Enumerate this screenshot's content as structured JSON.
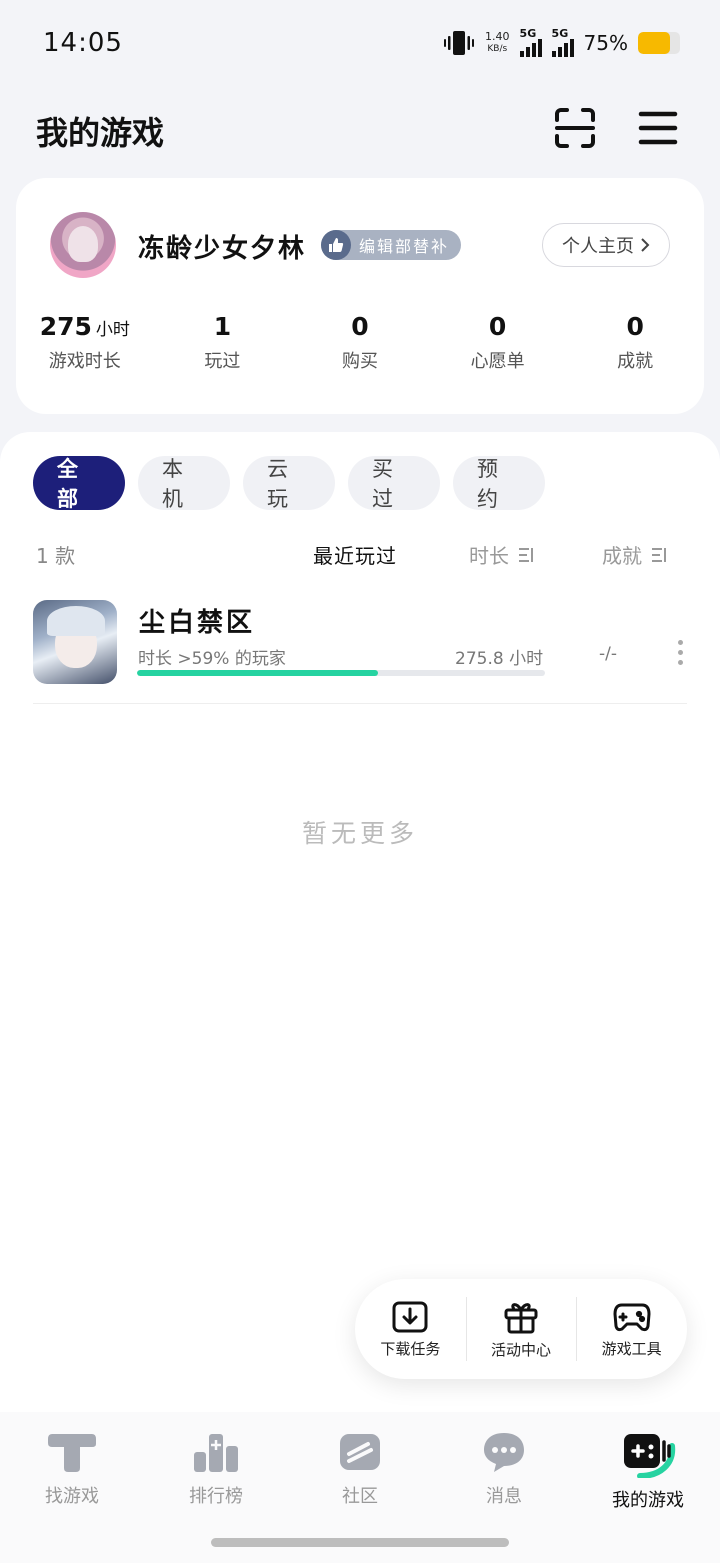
{
  "status_bar": {
    "time": "14:05",
    "net_speed": "1.40",
    "net_unit": "KB/s",
    "sim1": "5G",
    "sim2": "5G",
    "battery_pct": "75%",
    "battery_level": 0.75,
    "battery_color": "#f7b900"
  },
  "header": {
    "title": "我的游戏",
    "scan_icon": "scan-icon",
    "menu_icon": "menu-icon"
  },
  "profile": {
    "username": "冻龄少女夕林",
    "badge": "编辑部替补",
    "home_button": "个人主页",
    "stats": [
      {
        "value": "275",
        "unit": "小时",
        "label": "游戏时长"
      },
      {
        "value": "1",
        "unit": "",
        "label": "玩过"
      },
      {
        "value": "0",
        "unit": "",
        "label": "购买"
      },
      {
        "value": "0",
        "unit": "",
        "label": "心愿单"
      },
      {
        "value": "0",
        "unit": "",
        "label": "成就"
      }
    ]
  },
  "filters": {
    "chips": [
      "全部",
      "本机",
      "云玩",
      "买过",
      "预约"
    ],
    "active": "全部",
    "active_color": "#1d1f7a"
  },
  "sort": {
    "count": "1 款",
    "recent": "最近玩过",
    "duration": "时长",
    "achievements": "成就"
  },
  "games": [
    {
      "name": "尘白禁区",
      "rank_text": "时长 >59% 的玩家",
      "hours": "275.8 小时",
      "achievements": "-/-",
      "progress": 0.59,
      "progress_color": "#26d3a1"
    }
  ],
  "empty_text": "暂无更多",
  "tools": [
    {
      "label": "下载任务",
      "icon": "download-icon"
    },
    {
      "label": "活动中心",
      "icon": "gift-icon"
    },
    {
      "label": "游戏工具",
      "icon": "gamepad-icon"
    }
  ],
  "nav": [
    {
      "label": "找游戏",
      "icon": "find-game-icon"
    },
    {
      "label": "排行榜",
      "icon": "leaderboard-icon"
    },
    {
      "label": "社区",
      "icon": "community-icon"
    },
    {
      "label": "消息",
      "icon": "message-icon"
    },
    {
      "label": "我的游戏",
      "icon": "my-games-icon",
      "active": true
    }
  ]
}
